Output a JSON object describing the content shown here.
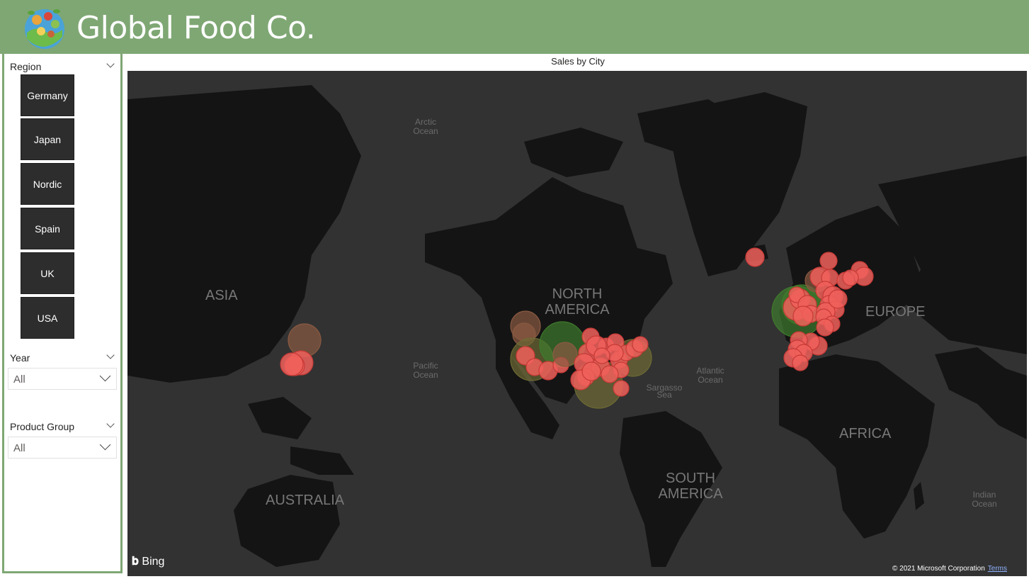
{
  "header": {
    "title": "Global Food Co.",
    "logo_icon": "globe-food-logo"
  },
  "sidebar": {
    "region": {
      "label": "Region",
      "items": [
        "Germany",
        "Japan",
        "Nordic",
        "Spain",
        "UK",
        "USA"
      ]
    },
    "year": {
      "label": "Year",
      "value": "All"
    },
    "product_group": {
      "label": "Product Group",
      "value": "All"
    }
  },
  "map": {
    "title": "Sales by City",
    "provider": "Bing",
    "copyright": "© 2021 Microsoft Corporation",
    "terms_link": "Terms",
    "continent_labels": [
      "ASIA",
      "NORTH AMERICA",
      "EUROPE",
      "AFRICA",
      "SOUTH AMERICA",
      "AUSTRALIA"
    ],
    "ocean_labels": [
      "Arctic Ocean",
      "Pacific Ocean",
      "Atlantic Ocean",
      "Sargasso Sea",
      "Indian Ocean"
    ],
    "bubble_colors": {
      "red": "#f0605c",
      "brown": "#8a5a42",
      "green": "#3f7a2c",
      "olive": "#6e6a34"
    }
  }
}
